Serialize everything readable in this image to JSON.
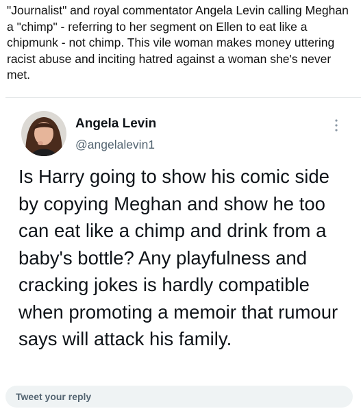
{
  "caption": "\"Journalist\" and royal commentator Angela Levin calling Meghan a \"chimp\" - referring to her segment on Ellen to eat like a chipmunk - not chimp. This vile woman makes money uttering racist abuse and inciting hatred against a woman she's never met.",
  "tweet": {
    "author_name": "Angela Levin",
    "author_handle": "@angelalevin1",
    "text": "Is Harry going to show his comic side by copying Meghan and show he too can eat like a chimp and drink from a baby's bottle?  Any playfulness and cracking jokes is hardly compatible  when promoting a memoir that rumour says will attack his family.",
    "more_icon": "more-vertical-dots-icon"
  },
  "reply": {
    "placeholder": "Tweet your reply"
  }
}
